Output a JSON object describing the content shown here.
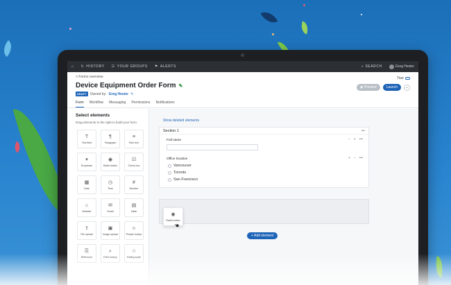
{
  "topbar": {
    "home_icon": "home-icon",
    "history": "HISTORY",
    "your_groups": "YOUR GROUPS",
    "alerts": "ALERTS",
    "search": "SEARCH",
    "user": "Greg Hester"
  },
  "header": {
    "breadcrumb": "< Forms overview",
    "title": "Device Equipment Order Form",
    "status": "DRAFT",
    "owned_by": "Owned by:",
    "owner": "Greg Hester",
    "tour": "Tour",
    "preview": "Preview",
    "launch": "Launch",
    "tabs": [
      "Form",
      "Workflow",
      "Messaging",
      "Permissions",
      "Notifications"
    ]
  },
  "sidebar": {
    "title": "Select elements",
    "description": "Drag elements to the right to build your form.",
    "elements": [
      {
        "label": "Text field",
        "icon": "T"
      },
      {
        "label": "Paragraph",
        "icon": "¶"
      },
      {
        "label": "Rich text",
        "icon": "≡"
      },
      {
        "label": "Dropdown",
        "icon": "▾"
      },
      {
        "label": "Radio button",
        "icon": "◉"
      },
      {
        "label": "Check box",
        "icon": "☑"
      },
      {
        "label": "Date",
        "icon": "▦"
      },
      {
        "label": "Time",
        "icon": "◷"
      },
      {
        "label": "Number",
        "icon": "#"
      },
      {
        "label": "Website",
        "icon": "⌂"
      },
      {
        "label": "Email",
        "icon": "✉"
      },
      {
        "label": "Table",
        "icon": "▤"
      },
      {
        "label": "File upload",
        "icon": "⇪"
      },
      {
        "label": "Image upload",
        "icon": "▣"
      },
      {
        "label": "People lookup",
        "icon": "☺"
      },
      {
        "label": "Reference",
        "icon": "⎘"
      },
      {
        "label": "Field lookup",
        "icon": "⌕"
      },
      {
        "label": "Rating scale",
        "icon": "☆"
      }
    ]
  },
  "canvas": {
    "show_deleted": "Show deleted elements",
    "section_title": "Section 1",
    "full_name_label": "Full name",
    "office_label": "Office location",
    "options": [
      "Vancouver",
      "Toronto",
      "San Francisco"
    ],
    "drag_label": "Radio button",
    "drag_icon": "◉",
    "add_element": "+ Add element"
  },
  "colors": {
    "accent": "#1d63b7",
    "background": "#1b6fb8"
  }
}
